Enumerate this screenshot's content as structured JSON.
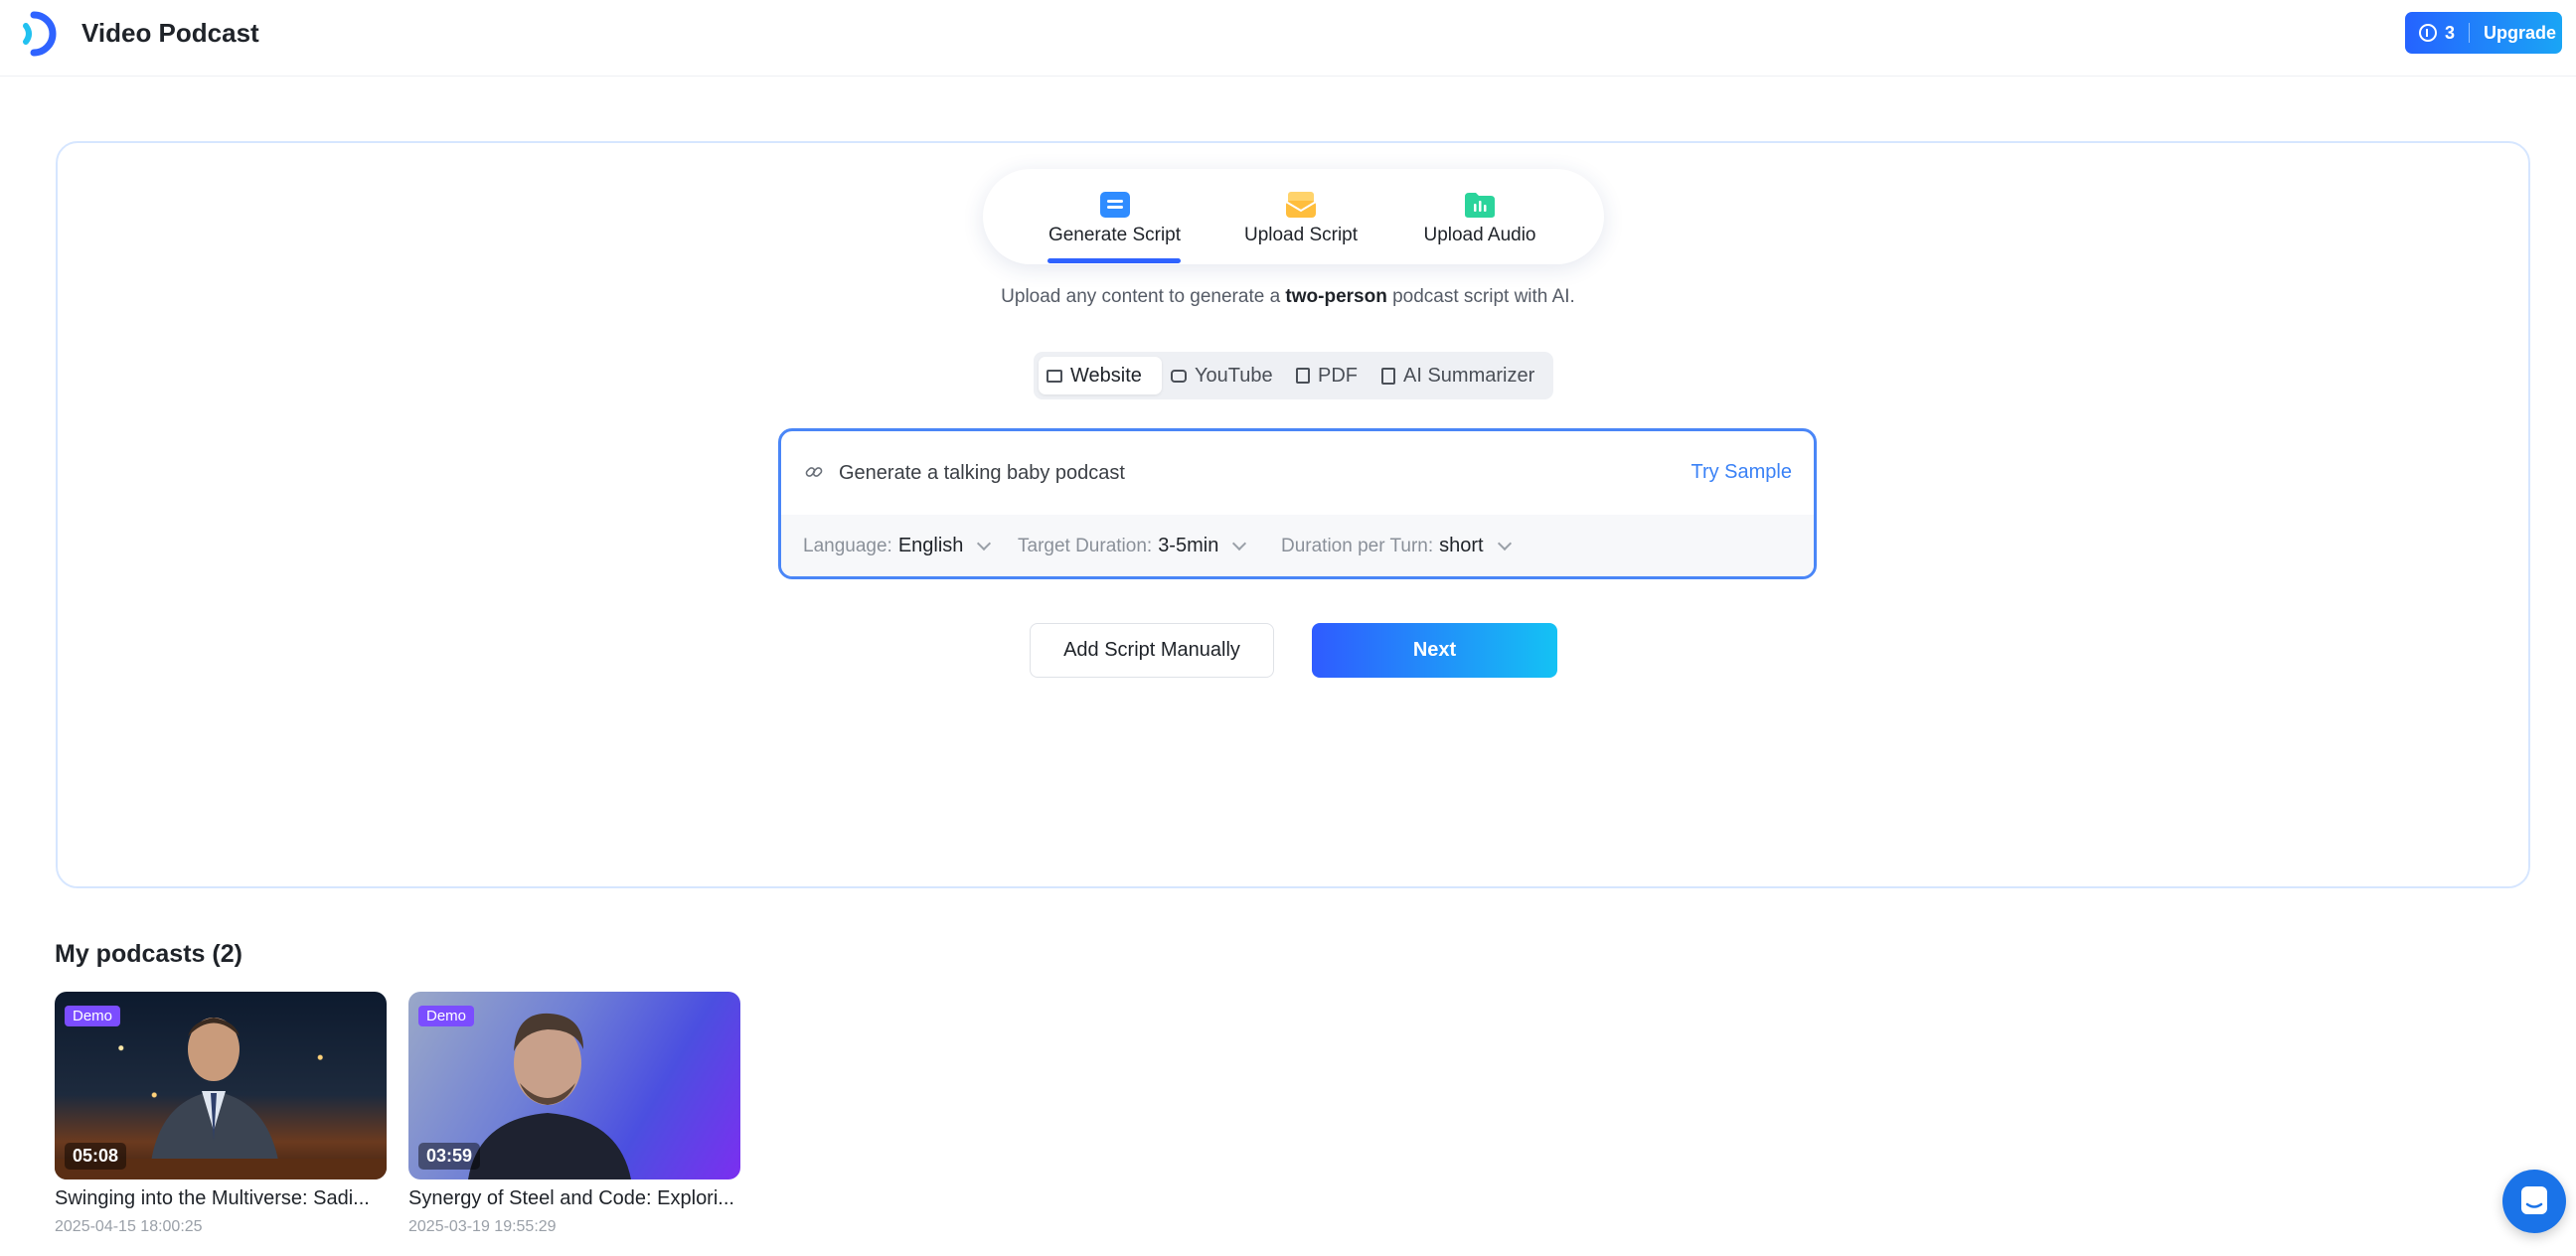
{
  "header": {
    "title": "Video Podcast",
    "credits": "3",
    "upgrade_label": "Upgrade",
    "accent_color": "#2563ff"
  },
  "mode_tabs": [
    {
      "label": "Generate Script",
      "icon": "script-file-icon",
      "active": true
    },
    {
      "label": "Upload Script",
      "icon": "upload-envelope-icon",
      "active": false
    },
    {
      "label": "Upload Audio",
      "icon": "audio-folder-icon",
      "active": false
    }
  ],
  "subtitle": {
    "prefix": "Upload any content to generate a ",
    "bold": "two-person",
    "suffix": " podcast script with AI."
  },
  "source_tabs": [
    {
      "label": "Website",
      "icon": "monitor-icon",
      "active": true
    },
    {
      "label": "YouTube",
      "icon": "youtube-icon",
      "active": false
    },
    {
      "label": "PDF",
      "icon": "pdf-icon",
      "active": false
    },
    {
      "label": "AI Summarizer",
      "icon": "document-icon",
      "active": false
    }
  ],
  "input": {
    "value": "Generate a talking baby podcast",
    "try_sample": "Try Sample",
    "options": {
      "language_label": "Language:",
      "language_value": "English",
      "duration_label": "Target Duration:",
      "duration_value": "3-5min",
      "turn_label": "Duration per Turn:",
      "turn_value": "short"
    }
  },
  "actions": {
    "manual_label": "Add Script Manually",
    "next_label": "Next"
  },
  "my_podcasts": {
    "title": "My podcasts (2)",
    "items": [
      {
        "badge": "Demo",
        "duration": "05:08",
        "title": "Swinging into the Multiverse: Sadi...",
        "date": "2025-04-15 18:00:25"
      },
      {
        "badge": "Demo",
        "duration": "03:59",
        "title": "Synergy of Steel and Code: Explori...",
        "date": "2025-03-19 19:55:29"
      }
    ]
  }
}
